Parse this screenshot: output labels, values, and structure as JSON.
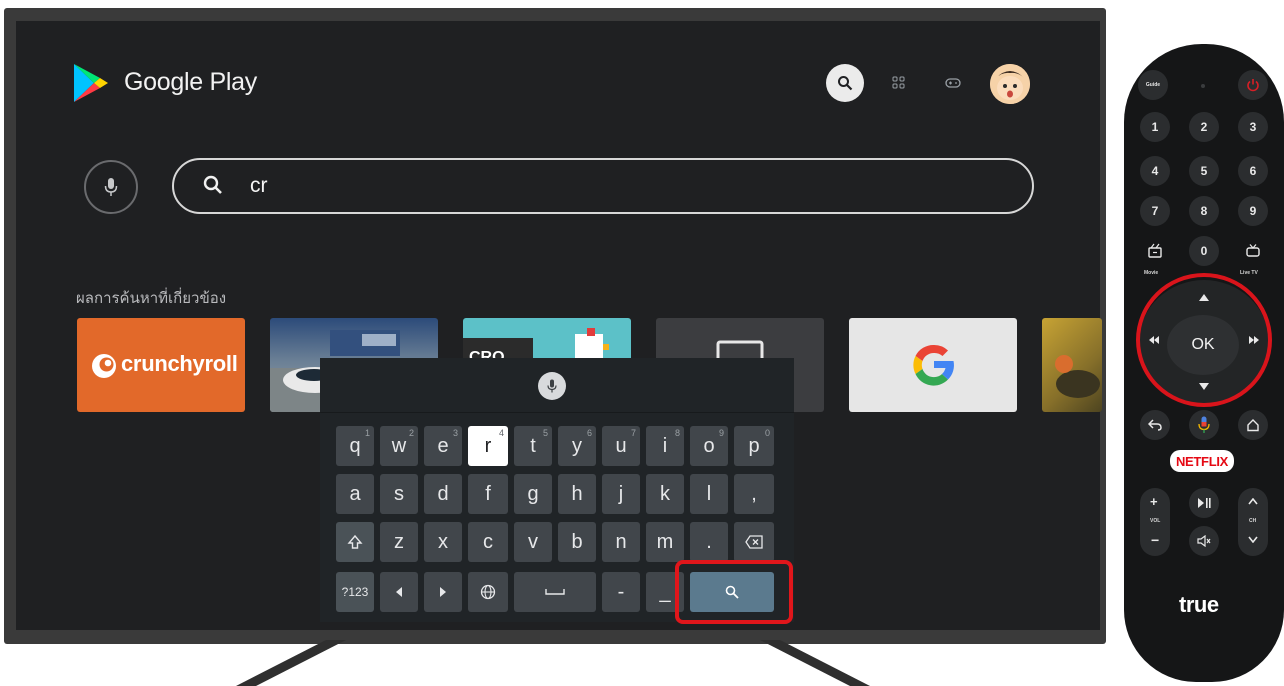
{
  "app": {
    "title": "Google Play"
  },
  "header_icons": [
    "search-icon",
    "apps-grid-icon",
    "gamepad-icon",
    "profile-avatar"
  ],
  "search": {
    "query": "cr"
  },
  "results": {
    "label": "ผลการค้นหาที่เกี่ยวข้อง",
    "tiles": [
      {
        "name": "crunchyroll",
        "text": "crunchyroll"
      },
      {
        "name": "racing-game",
        "text": ""
      },
      {
        "name": "crossy-road",
        "text": "CRO"
      },
      {
        "name": "dark-tile",
        "text": ""
      },
      {
        "name": "google",
        "text": "G"
      },
      {
        "name": "game-tile",
        "text": ""
      }
    ]
  },
  "keyboard": {
    "row1": [
      {
        "k": "q",
        "n": "1"
      },
      {
        "k": "w",
        "n": "2"
      },
      {
        "k": "e",
        "n": "3"
      },
      {
        "k": "r",
        "n": "4"
      },
      {
        "k": "t",
        "n": "5"
      },
      {
        "k": "y",
        "n": "6"
      },
      {
        "k": "u",
        "n": "7"
      },
      {
        "k": "i",
        "n": "8"
      },
      {
        "k": "o",
        "n": "9"
      },
      {
        "k": "p",
        "n": "0"
      }
    ],
    "row2": [
      "a",
      "s",
      "d",
      "f",
      "g",
      "h",
      "j",
      "k",
      "l",
      ","
    ],
    "row3": [
      "z",
      "x",
      "c",
      "v",
      "b",
      "n",
      "m",
      "."
    ],
    "row4": {
      "symbols": "?123",
      "dash": "-",
      "underscore": "_"
    },
    "selected_key": "r"
  },
  "remote": {
    "guide": "Guide",
    "digits": [
      "1",
      "2",
      "3",
      "4",
      "5",
      "6",
      "7",
      "8",
      "9",
      "0"
    ],
    "movie_label": "Movie",
    "livetv_label": "Live TV",
    "ok": "OK",
    "netflix": "NETFLIX",
    "vol_label": "VOL",
    "ch_label": "CH",
    "brand": "true"
  },
  "colors": {
    "highlight": "#e0161b",
    "netflix": "#e50914",
    "crunchyroll": "#e2692a"
  }
}
